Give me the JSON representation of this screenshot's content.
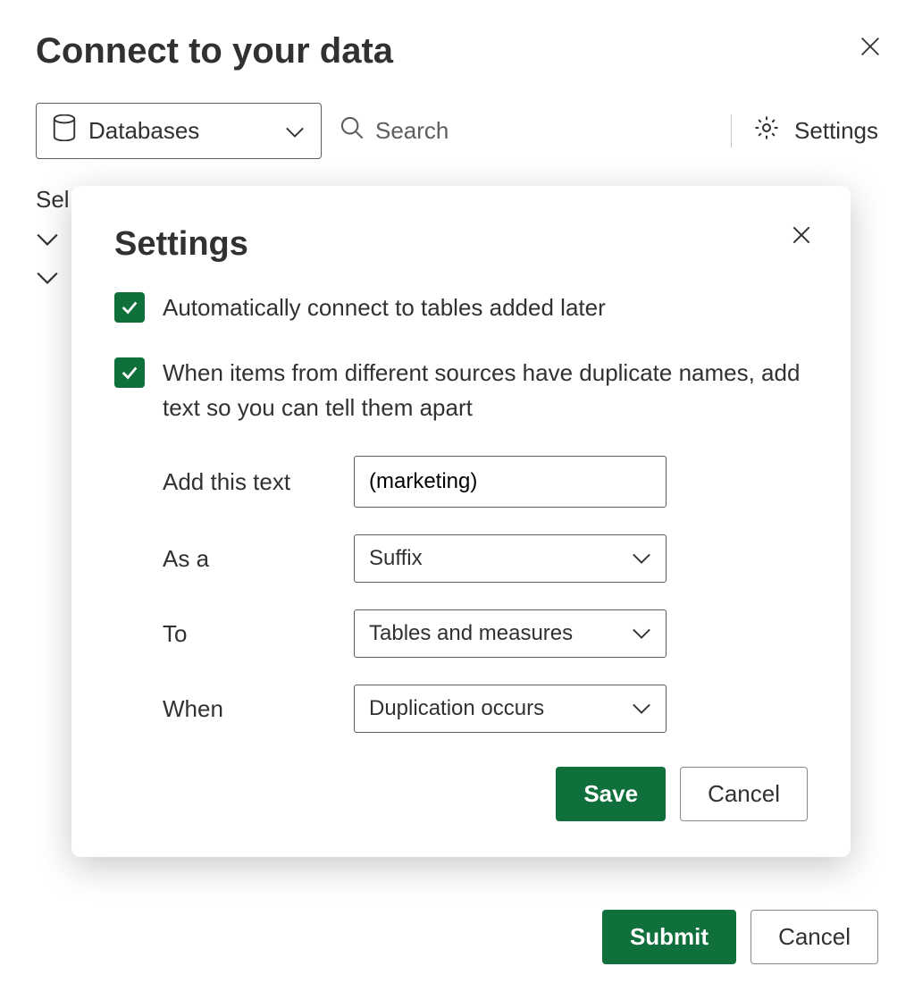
{
  "page": {
    "title": "Connect to your data",
    "body_label": "Sel",
    "footer": {
      "submit": "Submit",
      "cancel": "Cancel"
    }
  },
  "toolbar": {
    "category_label": "Databases",
    "search_placeholder": "Search",
    "settings_label": "Settings"
  },
  "modal": {
    "title": "Settings",
    "option_auto_connect": "Automatically connect to tables added later",
    "option_dup_names": "When items from different sources have duplicate names, add text so you can tell them apart",
    "fields": {
      "add_text_label": "Add this text",
      "add_text_value": "(marketing)",
      "as_a_label": "As a",
      "as_a_value": "Suffix",
      "to_label": "To",
      "to_value": "Tables and measures",
      "when_label": "When",
      "when_value": "Duplication occurs"
    },
    "buttons": {
      "save": "Save",
      "cancel": "Cancel"
    }
  }
}
